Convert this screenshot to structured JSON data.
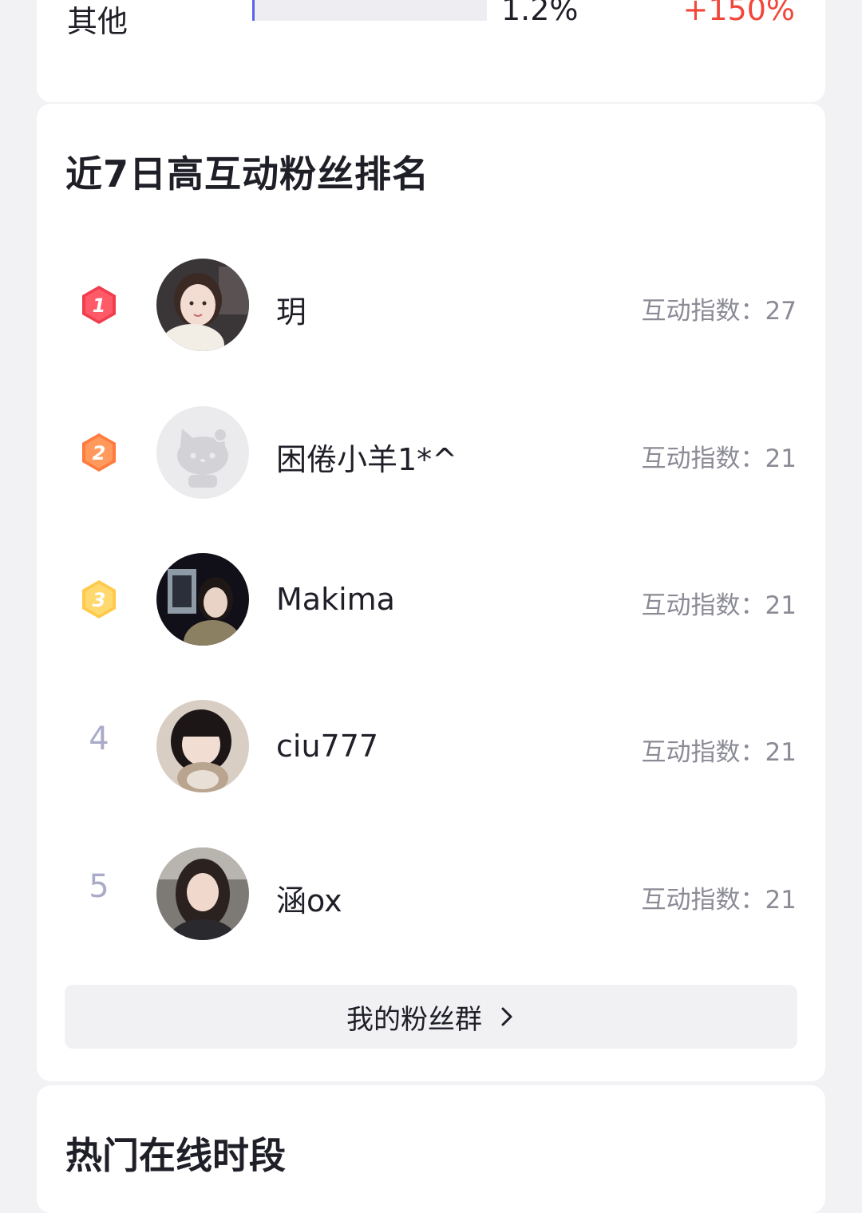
{
  "distribution_partial": {
    "label": "其他",
    "percent": "1.2%",
    "bar_fill_percent": 1.2,
    "change": "+150%"
  },
  "fan_ranking": {
    "title": "近7日高互动粉丝排名",
    "score_prefix": "互动指数：",
    "items": [
      {
        "rank": "1",
        "name": "玥",
        "score": "27",
        "badge_color": "#f23d4f",
        "avatar": "photo-girl-1"
      },
      {
        "rank": "2",
        "name": "困倦小羊1*^",
        "score": "21",
        "badge_color": "#ff7a3d",
        "avatar": "hello-kitty-placeholder"
      },
      {
        "rank": "3",
        "name": "Makima",
        "score": "21",
        "badge_color": "#ffc94a",
        "avatar": "photo-girl-dark"
      },
      {
        "rank": "4",
        "name": "ciu777",
        "score": "21",
        "avatar": "photo-girl-cat"
      },
      {
        "rank": "5",
        "name": "涵ox",
        "score": "21",
        "avatar": "photo-girl-5"
      }
    ],
    "group_button_label": "我的粉丝群"
  },
  "online_hours": {
    "title": "热门在线时段"
  },
  "colors": {
    "accent_bar": "#5b63e6",
    "positive_change": "#f2463b",
    "rank_gray": "#a9abc9"
  }
}
